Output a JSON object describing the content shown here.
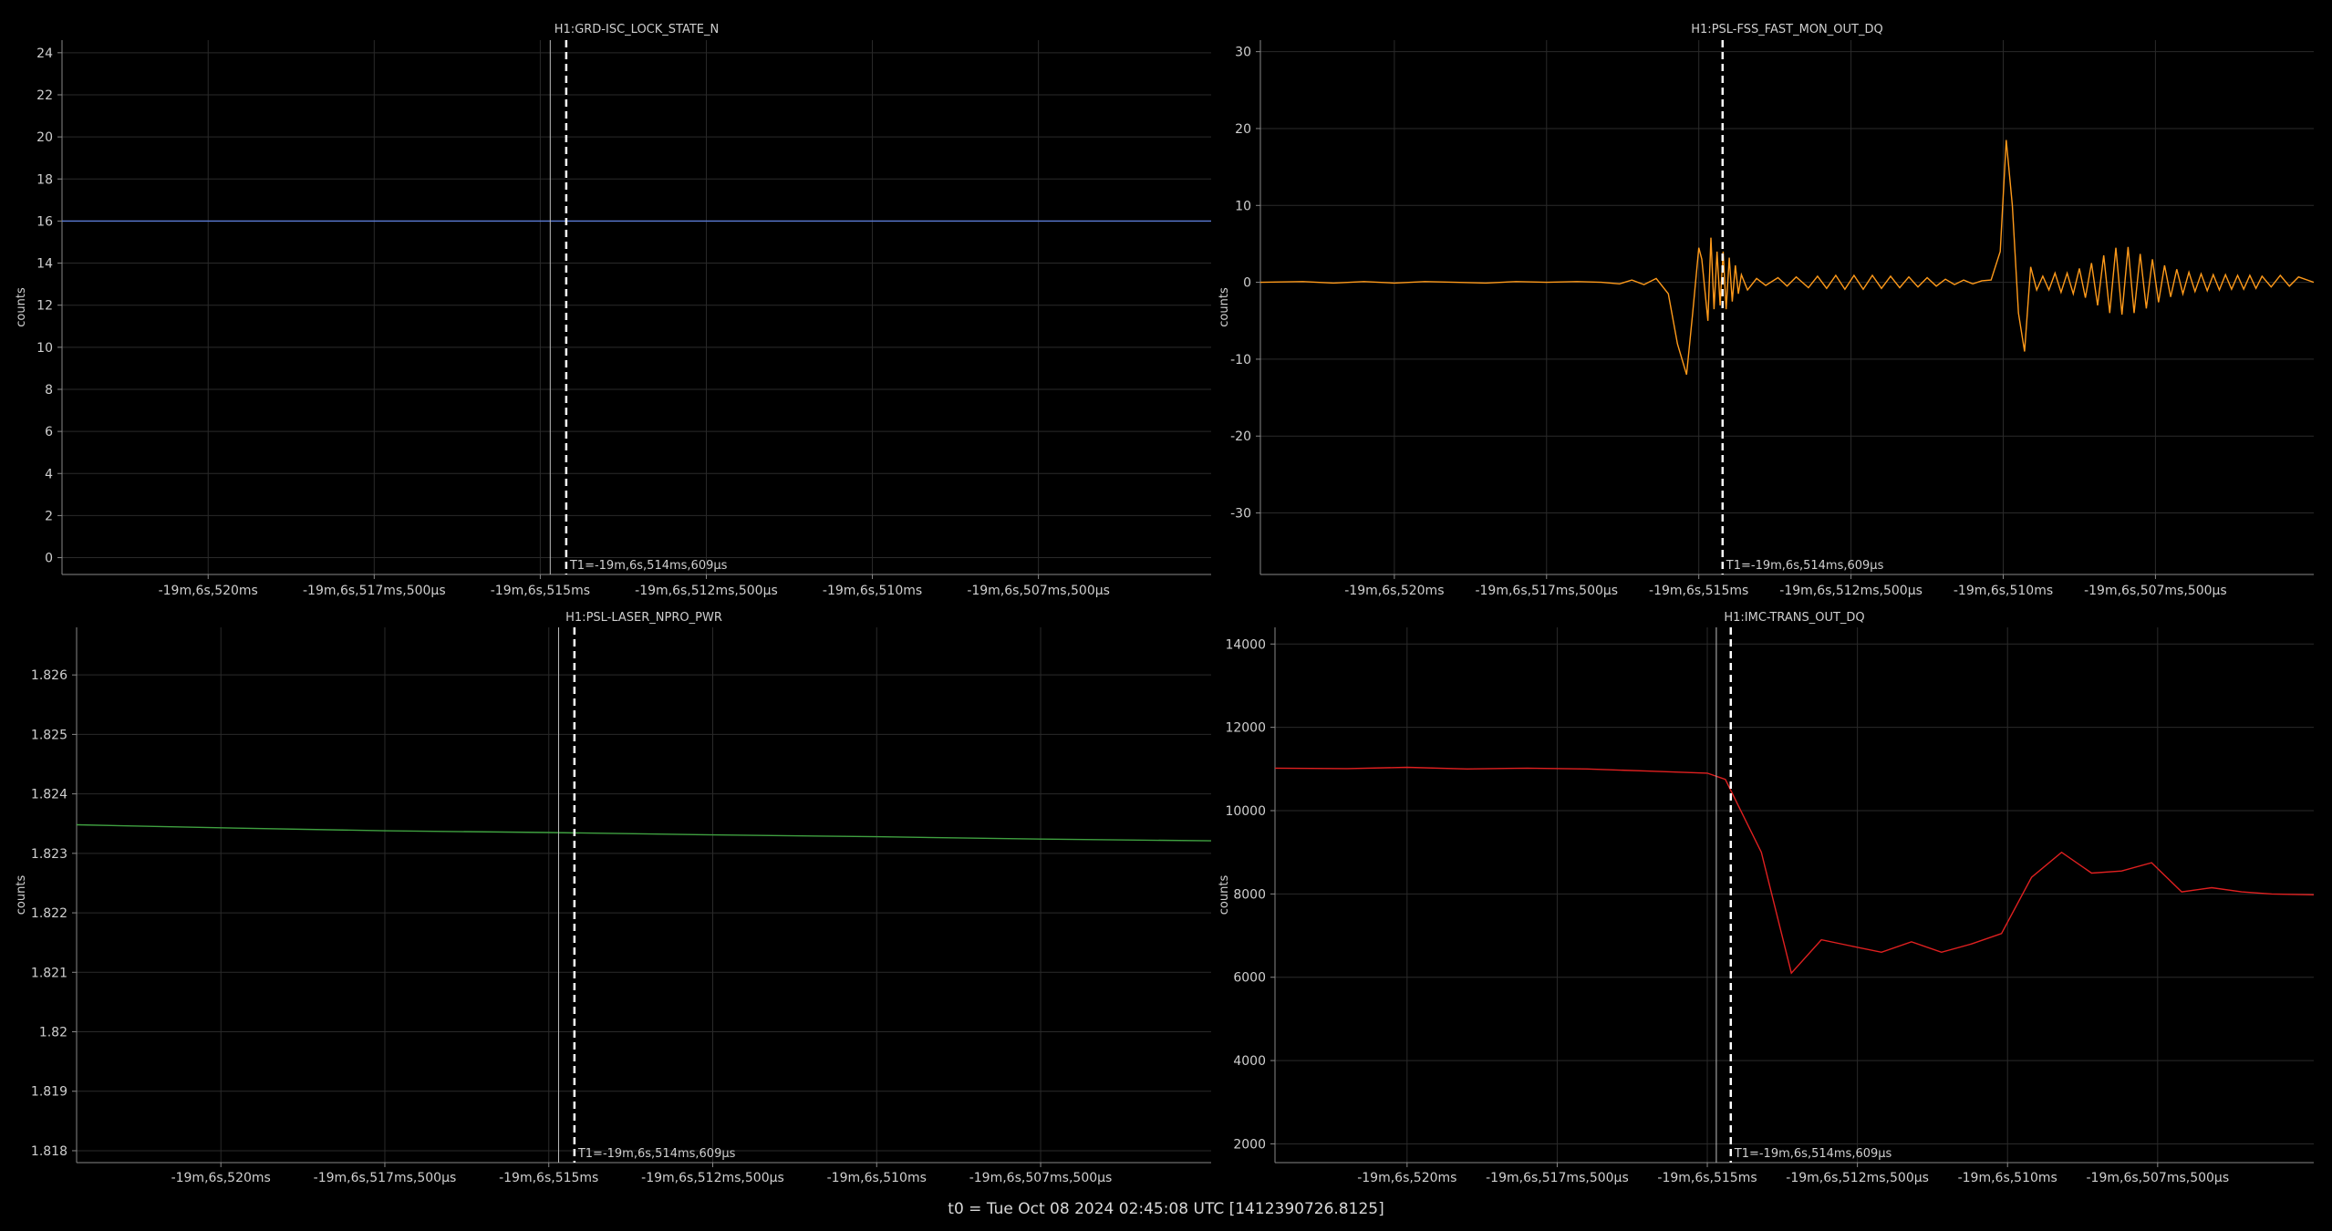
{
  "footer": {
    "t0_label": "t0 = Tue Oct 08 2024 02:45:08 UTC [1412390726.8125]"
  },
  "cursor_label": "T1=-19m,6s,514ms,609µs",
  "colors": {
    "background": "#000000",
    "grid": "#2a2a2a",
    "axis": "#888888",
    "text": "#cfcfcf",
    "cursor": "#ffffff",
    "cursor_secondary": "#bdbdbd"
  },
  "chart_data": [
    {
      "type": "line",
      "title": "H1:GRD-ISC_LOCK_STATE_N",
      "ylabel": "counts",
      "xlabel": "",
      "x_tick_labels": [
        "-19m,6s,520ms",
        "-19m,6s,517ms,500µs",
        "-19m,6s,515ms",
        "-19m,6s,512ms,500µs",
        "-19m,6s,510ms",
        "-19m,6s,507ms,500µs"
      ],
      "x_ticks_ms": [
        -1126520,
        -1126517.5,
        -1126515,
        -1126512.5,
        -1126510,
        -1126507.5
      ],
      "xlim_ms": [
        -1126522.2,
        -1126504.9
      ],
      "cursor_ms": -1126514.609,
      "secondary_cursor_ms": -1126514.85,
      "ylim": [
        -0.8,
        24.6
      ],
      "yticks": [
        0,
        2,
        4,
        6,
        8,
        10,
        12,
        14,
        16,
        18,
        20,
        22,
        24
      ],
      "ytick_labels": [
        "0",
        "2",
        "4",
        "6",
        "8",
        "10",
        "12",
        "14",
        "16",
        "18",
        "20",
        "22",
        "24"
      ],
      "grid": true,
      "color": "#5b7bd5",
      "series": [
        {
          "x": [
            -1126522.2,
            -1126504.9
          ],
          "y": [
            16,
            16
          ]
        }
      ]
    },
    {
      "type": "line",
      "title": "H1:PSL-FSS_FAST_MON_OUT_DQ",
      "ylabel": "counts",
      "xlabel": "",
      "x_tick_labels": [
        "-19m,6s,520ms",
        "-19m,6s,517ms,500µs",
        "-19m,6s,515ms",
        "-19m,6s,512ms,500µs",
        "-19m,6s,510ms",
        "-19m,6s,507ms,500µs"
      ],
      "x_ticks_ms": [
        -1126520,
        -1126517.5,
        -1126515,
        -1126512.5,
        -1126510,
        -1126507.5
      ],
      "xlim_ms": [
        -1126522.2,
        -1126504.9
      ],
      "cursor_ms": -1126514.609,
      "ylim": [
        -38,
        31.5
      ],
      "yticks": [
        -30,
        -20,
        -10,
        0,
        10,
        20,
        30
      ],
      "ytick_labels": [
        "-30",
        "-20",
        "-10",
        "0",
        "10",
        "20",
        "30"
      ],
      "grid": true,
      "color": "#ff9a1a",
      "series": [
        {
          "x": [
            -1126522.2,
            -1126521.5,
            -1126521.0,
            -1126520.5,
            -1126520.0,
            -1126519.5,
            -1126519.0,
            -1126518.5,
            -1126518.0,
            -1126517.5,
            -1126517.0,
            -1126516.6,
            -1126516.3,
            -1126516.1,
            -1126515.9,
            -1126515.7,
            -1126515.5,
            -1126515.35,
            -1126515.2,
            -1126515.1,
            -1126515.0,
            -1126514.95,
            -1126514.85,
            -1126514.8,
            -1126514.75,
            -1126514.7,
            -1126514.65,
            -1126514.6,
            -1126514.55,
            -1126514.5,
            -1126514.45,
            -1126514.4,
            -1126514.35,
            -1126514.3,
            -1126514.2,
            -1126514.05,
            -1126513.9,
            -1126513.7,
            -1126513.55,
            -1126513.4,
            -1126513.2,
            -1126513.05,
            -1126512.9,
            -1126512.75,
            -1126512.6,
            -1126512.45,
            -1126512.3,
            -1126512.15,
            -1126512.0,
            -1126511.85,
            -1126511.7,
            -1126511.55,
            -1126511.4,
            -1126511.25,
            -1126511.1,
            -1126510.95,
            -1126510.8,
            -1126510.65,
            -1126510.5,
            -1126510.35,
            -1126510.2,
            -1126510.05,
            -1126509.95,
            -1126509.85,
            -1126509.75,
            -1126509.65,
            -1126509.55,
            -1126509.45,
            -1126509.35,
            -1126509.25,
            -1126509.15,
            -1126509.05,
            -1126508.95,
            -1126508.85,
            -1126508.75,
            -1126508.65,
            -1126508.55,
            -1126508.45,
            -1126508.35,
            -1126508.25,
            -1126508.15,
            -1126508.05,
            -1126507.95,
            -1126507.85,
            -1126507.75,
            -1126507.65,
            -1126507.55,
            -1126507.45,
            -1126507.35,
            -1126507.25,
            -1126507.15,
            -1126507.05,
            -1126506.95,
            -1126506.85,
            -1126506.75,
            -1126506.65,
            -1126506.55,
            -1126506.45,
            -1126506.35,
            -1126506.25,
            -1126506.15,
            -1126506.05,
            -1126505.95,
            -1126505.85,
            -1126505.75,
            -1126505.6,
            -1126505.45,
            -1126505.3,
            -1126505.15,
            -1126504.9
          ],
          "y": [
            0.0,
            0.1,
            -0.1,
            0.1,
            -0.1,
            0.1,
            0.0,
            -0.1,
            0.1,
            0.0,
            0.1,
            0.0,
            -0.2,
            0.3,
            -0.3,
            0.5,
            -1.5,
            -8.0,
            -12.0,
            -4.0,
            4.5,
            3.0,
            -5.0,
            5.8,
            -3.5,
            4.0,
            -3.0,
            4.0,
            -3.5,
            3.2,
            -2.5,
            2.2,
            -1.5,
            1.0,
            -1.0,
            0.5,
            -0.4,
            0.6,
            -0.5,
            0.7,
            -0.7,
            0.8,
            -0.8,
            0.9,
            -0.9,
            0.9,
            -0.9,
            0.9,
            -0.8,
            0.8,
            -0.7,
            0.7,
            -0.6,
            0.6,
            -0.5,
            0.4,
            -0.3,
            0.3,
            -0.2,
            0.2,
            0.3,
            4.0,
            18.5,
            10.0,
            -4.0,
            -9.0,
            2.0,
            -1.0,
            0.8,
            -1.0,
            1.2,
            -1.3,
            1.2,
            -1.5,
            1.8,
            -2.0,
            2.5,
            -3.0,
            3.5,
            -4.0,
            4.5,
            -4.2,
            4.6,
            -4.0,
            3.7,
            -3.4,
            3.0,
            -2.6,
            2.2,
            -1.9,
            1.7,
            -1.5,
            1.3,
            -1.2,
            1.1,
            -1.1,
            1.0,
            -1.0,
            1.0,
            -0.9,
            0.9,
            -0.9,
            0.9,
            -0.8,
            0.8,
            -0.6,
            0.9,
            -0.5,
            0.7,
            0.0
          ]
        }
      ]
    },
    {
      "type": "line",
      "title": "H1:PSL-LASER_NPRO_PWR",
      "ylabel": "counts",
      "xlabel": "",
      "x_tick_labels": [
        "-19m,6s,520ms",
        "-19m,6s,517ms,500µs",
        "-19m,6s,515ms",
        "-19m,6s,512ms,500µs",
        "-19m,6s,510ms",
        "-19m,6s,507ms,500µs"
      ],
      "x_ticks_ms": [
        -1126520,
        -1126517.5,
        -1126515,
        -1126512.5,
        -1126510,
        -1126507.5
      ],
      "xlim_ms": [
        -1126522.2,
        -1126504.9
      ],
      "cursor_ms": -1126514.609,
      "secondary_cursor_ms": -1126514.85,
      "ylim": [
        1.8178,
        1.8268
      ],
      "yticks": [
        1.818,
        1.819,
        1.82,
        1.821,
        1.822,
        1.823,
        1.824,
        1.825,
        1.826
      ],
      "ytick_labels": [
        "1.818",
        "1.819",
        "1.82",
        "1.821",
        "1.822",
        "1.823",
        "1.824",
        "1.825",
        "1.826"
      ],
      "grid": true,
      "color": "#3fa040",
      "series": [
        {
          "x": [
            -1126522.2,
            -1126520.0,
            -1126517.5,
            -1126515.0,
            -1126512.5,
            -1126510.0,
            -1126507.5,
            -1126504.9
          ],
          "y": [
            1.82348,
            1.82343,
            1.82338,
            1.82335,
            1.82331,
            1.82328,
            1.82324,
            1.82321
          ]
        }
      ]
    },
    {
      "type": "line",
      "title": "H1:IMC-TRANS_OUT_DQ",
      "ylabel": "counts",
      "xlabel": "",
      "x_tick_labels": [
        "-19m,6s,520ms",
        "-19m,6s,517ms,500µs",
        "-19m,6s,515ms",
        "-19m,6s,512ms,500µs",
        "-19m,6s,510ms",
        "-19m,6s,507ms,500µs"
      ],
      "x_ticks_ms": [
        -1126520,
        -1126517.5,
        -1126515,
        -1126512.5,
        -1126510,
        -1126507.5
      ],
      "xlim_ms": [
        -1126522.2,
        -1126504.9
      ],
      "cursor_ms": -1126514.609,
      "secondary_cursor_ms": -1126514.85,
      "ylim": [
        1550,
        14400
      ],
      "yticks": [
        2000,
        4000,
        6000,
        8000,
        10000,
        12000,
        14000
      ],
      "ytick_labels": [
        "2000",
        "4000",
        "6000",
        "8000",
        "10000",
        "12000",
        "14000"
      ],
      "grid": true,
      "color": "#e02020",
      "series": [
        {
          "x": [
            -1126522.2,
            -1126521.0,
            -1126520.0,
            -1126519.0,
            -1126518.0,
            -1126517.0,
            -1126516.0,
            -1126515.0,
            -1126514.7,
            -1126514.1,
            -1126513.6,
            -1126513.1,
            -1126512.6,
            -1126512.1,
            -1126511.6,
            -1126511.1,
            -1126510.6,
            -1126510.1,
            -1126509.6,
            -1126509.1,
            -1126508.6,
            -1126508.1,
            -1126507.6,
            -1126507.1,
            -1126506.6,
            -1126506.1,
            -1126505.6,
            -1126504.9
          ],
          "y": [
            11020,
            11010,
            11040,
            11000,
            11020,
            11000,
            10950,
            10900,
            10750,
            9000,
            6100,
            6900,
            6750,
            6600,
            6850,
            6600,
            6800,
            7050,
            8400,
            9000,
            8500,
            8550,
            8750,
            8050,
            8150,
            8050,
            8000,
            7980
          ]
        }
      ]
    }
  ]
}
